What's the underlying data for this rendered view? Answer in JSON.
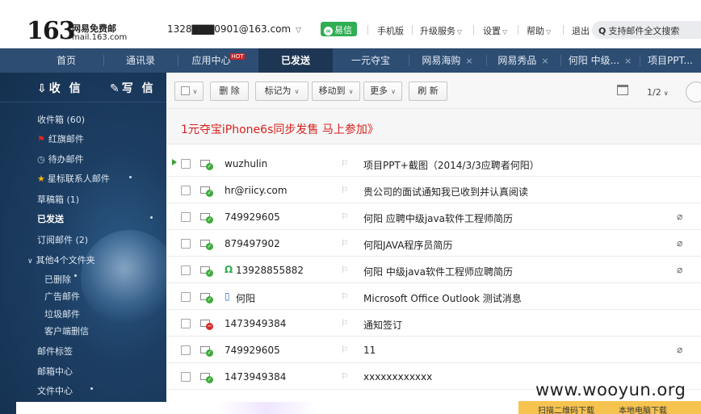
{
  "header": {
    "logo_number": "163",
    "logo_name": "网易免费邮",
    "logo_domain": "mail.163.com",
    "account": "1328▇▇▇0901@163.com",
    "yixin": "易信",
    "links": [
      "手机版",
      "升级服务",
      "设置",
      "帮助",
      "退出"
    ],
    "search_placeholder": "支持邮件全文搜索"
  },
  "tabs": [
    "首页",
    "通讯录",
    "应用中心",
    "已发送",
    "一元夺宝",
    "网易海购",
    "网易秀品",
    "何阳 中级...",
    "项目PPT..."
  ],
  "hot_badge": "HOT",
  "sidebar": {
    "receive": "收 信",
    "compose": "写 信",
    "items": {
      "inbox": "收件箱 (60)",
      "flagged": "红旗邮件",
      "pending": "待办邮件",
      "starred": "星标联系人邮件",
      "drafts": "草稿箱 (1)",
      "sent": "已发送",
      "subscriptions": "订阅邮件 (2)",
      "other_folders": "其他4个文件夹",
      "deleted": "已删除",
      "ads": "广告邮件",
      "spam": "垃圾邮件",
      "client_deleted": "客户端删信",
      "tags": "邮件标签",
      "center": "邮箱中心",
      "files": "文件中心"
    }
  },
  "toolbar": {
    "delete": "删 除",
    "mark_as": "标记为",
    "move_to": "移动到",
    "more": "更多",
    "refresh": "刷 新",
    "pagination": "1/2"
  },
  "promo": "1元夺宝iPhone6s同步发售 马上参加》",
  "messages": [
    {
      "sender": "wuzhulin",
      "subject": "项目PPT+截图（2014/3/3应聘者何阳）",
      "status": "sent",
      "attachment": false,
      "sender_icon": ""
    },
    {
      "sender": "hr@riicy.com",
      "subject": "贵公司的面试通知我已收到并认真阅读",
      "status": "sent",
      "attachment": false,
      "sender_icon": ""
    },
    {
      "sender": "749929605",
      "subject": "何阳 应聘中级java软件工程师简历",
      "status": "sent",
      "attachment": true,
      "sender_icon": ""
    },
    {
      "sender": "879497902",
      "subject": "何阳JAVA程序员简历",
      "status": "sent",
      "attachment": true,
      "sender_icon": ""
    },
    {
      "sender": "13928855882",
      "subject": "何阳 中级java软件工程师应聘简历",
      "status": "sent",
      "attachment": true,
      "sender_icon": "yixin-icon"
    },
    {
      "sender": "何阳",
      "subject": "Microsoft Office Outlook 测试消息",
      "status": "sent",
      "attachment": false,
      "sender_icon": "phone-icon"
    },
    {
      "sender": "1473949384",
      "subject": "通知签订",
      "status": "failed",
      "attachment": false,
      "sender_icon": ""
    },
    {
      "sender": "749929605",
      "subject": "11",
      "status": "sent",
      "attachment": true,
      "sender_icon": ""
    },
    {
      "sender": "1473949384",
      "subject": "xxxxxxxxxxxx",
      "status": "sent",
      "attachment": false,
      "sender_icon": ""
    }
  ],
  "watermark": "www.wooyun.org",
  "bottom_strip": [
    "扫描二维码下载",
    "本地电脑下载"
  ]
}
